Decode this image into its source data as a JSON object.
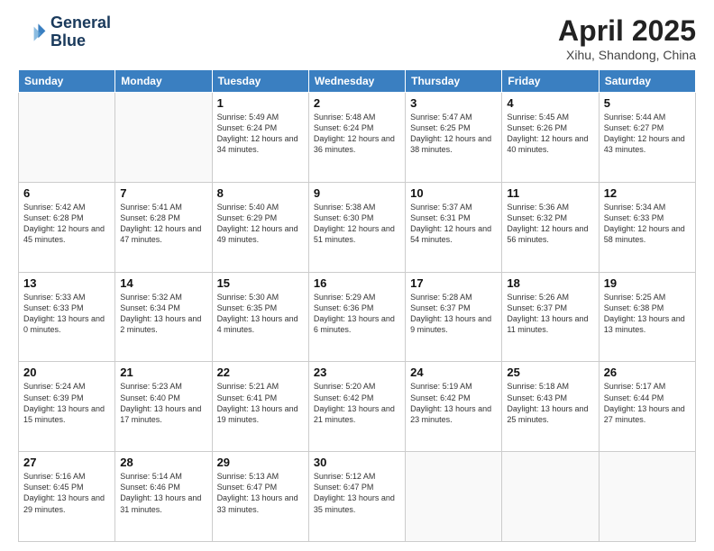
{
  "header": {
    "logo_line1": "General",
    "logo_line2": "Blue",
    "main_title": "April 2025",
    "sub_title": "Xihu, Shandong, China"
  },
  "days_of_week": [
    "Sunday",
    "Monday",
    "Tuesday",
    "Wednesday",
    "Thursday",
    "Friday",
    "Saturday"
  ],
  "weeks": [
    [
      {
        "day": "",
        "info": ""
      },
      {
        "day": "",
        "info": ""
      },
      {
        "day": "1",
        "info": "Sunrise: 5:49 AM\nSunset: 6:24 PM\nDaylight: 12 hours and 34 minutes."
      },
      {
        "day": "2",
        "info": "Sunrise: 5:48 AM\nSunset: 6:24 PM\nDaylight: 12 hours and 36 minutes."
      },
      {
        "day": "3",
        "info": "Sunrise: 5:47 AM\nSunset: 6:25 PM\nDaylight: 12 hours and 38 minutes."
      },
      {
        "day": "4",
        "info": "Sunrise: 5:45 AM\nSunset: 6:26 PM\nDaylight: 12 hours and 40 minutes."
      },
      {
        "day": "5",
        "info": "Sunrise: 5:44 AM\nSunset: 6:27 PM\nDaylight: 12 hours and 43 minutes."
      }
    ],
    [
      {
        "day": "6",
        "info": "Sunrise: 5:42 AM\nSunset: 6:28 PM\nDaylight: 12 hours and 45 minutes."
      },
      {
        "day": "7",
        "info": "Sunrise: 5:41 AM\nSunset: 6:28 PM\nDaylight: 12 hours and 47 minutes."
      },
      {
        "day": "8",
        "info": "Sunrise: 5:40 AM\nSunset: 6:29 PM\nDaylight: 12 hours and 49 minutes."
      },
      {
        "day": "9",
        "info": "Sunrise: 5:38 AM\nSunset: 6:30 PM\nDaylight: 12 hours and 51 minutes."
      },
      {
        "day": "10",
        "info": "Sunrise: 5:37 AM\nSunset: 6:31 PM\nDaylight: 12 hours and 54 minutes."
      },
      {
        "day": "11",
        "info": "Sunrise: 5:36 AM\nSunset: 6:32 PM\nDaylight: 12 hours and 56 minutes."
      },
      {
        "day": "12",
        "info": "Sunrise: 5:34 AM\nSunset: 6:33 PM\nDaylight: 12 hours and 58 minutes."
      }
    ],
    [
      {
        "day": "13",
        "info": "Sunrise: 5:33 AM\nSunset: 6:33 PM\nDaylight: 13 hours and 0 minutes."
      },
      {
        "day": "14",
        "info": "Sunrise: 5:32 AM\nSunset: 6:34 PM\nDaylight: 13 hours and 2 minutes."
      },
      {
        "day": "15",
        "info": "Sunrise: 5:30 AM\nSunset: 6:35 PM\nDaylight: 13 hours and 4 minutes."
      },
      {
        "day": "16",
        "info": "Sunrise: 5:29 AM\nSunset: 6:36 PM\nDaylight: 13 hours and 6 minutes."
      },
      {
        "day": "17",
        "info": "Sunrise: 5:28 AM\nSunset: 6:37 PM\nDaylight: 13 hours and 9 minutes."
      },
      {
        "day": "18",
        "info": "Sunrise: 5:26 AM\nSunset: 6:37 PM\nDaylight: 13 hours and 11 minutes."
      },
      {
        "day": "19",
        "info": "Sunrise: 5:25 AM\nSunset: 6:38 PM\nDaylight: 13 hours and 13 minutes."
      }
    ],
    [
      {
        "day": "20",
        "info": "Sunrise: 5:24 AM\nSunset: 6:39 PM\nDaylight: 13 hours and 15 minutes."
      },
      {
        "day": "21",
        "info": "Sunrise: 5:23 AM\nSunset: 6:40 PM\nDaylight: 13 hours and 17 minutes."
      },
      {
        "day": "22",
        "info": "Sunrise: 5:21 AM\nSunset: 6:41 PM\nDaylight: 13 hours and 19 minutes."
      },
      {
        "day": "23",
        "info": "Sunrise: 5:20 AM\nSunset: 6:42 PM\nDaylight: 13 hours and 21 minutes."
      },
      {
        "day": "24",
        "info": "Sunrise: 5:19 AM\nSunset: 6:42 PM\nDaylight: 13 hours and 23 minutes."
      },
      {
        "day": "25",
        "info": "Sunrise: 5:18 AM\nSunset: 6:43 PM\nDaylight: 13 hours and 25 minutes."
      },
      {
        "day": "26",
        "info": "Sunrise: 5:17 AM\nSunset: 6:44 PM\nDaylight: 13 hours and 27 minutes."
      }
    ],
    [
      {
        "day": "27",
        "info": "Sunrise: 5:16 AM\nSunset: 6:45 PM\nDaylight: 13 hours and 29 minutes."
      },
      {
        "day": "28",
        "info": "Sunrise: 5:14 AM\nSunset: 6:46 PM\nDaylight: 13 hours and 31 minutes."
      },
      {
        "day": "29",
        "info": "Sunrise: 5:13 AM\nSunset: 6:47 PM\nDaylight: 13 hours and 33 minutes."
      },
      {
        "day": "30",
        "info": "Sunrise: 5:12 AM\nSunset: 6:47 PM\nDaylight: 13 hours and 35 minutes."
      },
      {
        "day": "",
        "info": ""
      },
      {
        "day": "",
        "info": ""
      },
      {
        "day": "",
        "info": ""
      }
    ]
  ]
}
